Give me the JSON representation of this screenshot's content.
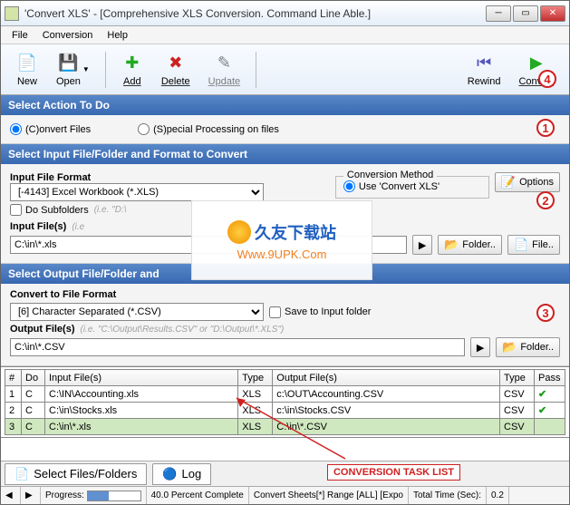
{
  "window": {
    "title": "'Convert XLS' - [Comprehensive XLS Conversion.  Command Line Able.]"
  },
  "menu": {
    "file": "File",
    "conversion": "Conversion",
    "help": "Help"
  },
  "toolbar": {
    "new": "New",
    "open": "Open",
    "add": "Add",
    "delete": "Delete",
    "update": "Update",
    "rewind": "Rewind",
    "convert": "Convert"
  },
  "annot": {
    "n1": "1",
    "n2": "2",
    "n3": "3",
    "n4": "4",
    "task_list": "CONVERSION TASK LIST"
  },
  "section1": {
    "header": "Select Action To Do",
    "opt_convert": "(C)onvert Files",
    "opt_special": "(S)pecial Processing on files"
  },
  "section2": {
    "header": "Select Input File/Folder and Format to Convert",
    "in_format_label": "Input File Format",
    "in_format_value": "[-4143] Excel Workbook (*.XLS)",
    "do_subfolders": "Do Subfolders",
    "hint_sub": "(i.e. \"D:\\",
    "in_files_label": "Input File(s)",
    "hint_input": "(i.e",
    "in_files_value": "C:\\in\\*.xls",
    "conv_method_legend": "Conversion Method",
    "conv_method_opt1": "Use 'Convert XLS'",
    "options_btn": "Options",
    "folder_btn": "Folder..",
    "file_btn": "File.."
  },
  "section3": {
    "header": "Select Output File/Folder and",
    "out_format_label": "Convert to File Format",
    "out_format_value": "[6] Character Separated (*.CSV)",
    "save_input": "Save to Input folder",
    "out_files_label": "Output File(s)",
    "hint_output": "(i.e. \"C:\\Output\\Results.CSV\" or \"D:\\Output\\*.XLS\")",
    "out_files_value": "C:\\in\\*.CSV",
    "folder_btn": "Folder.."
  },
  "table": {
    "headers": {
      "num": "#",
      "do": "Do",
      "input": "Input File(s)",
      "type1": "Type",
      "output": "Output File(s)",
      "type2": "Type",
      "pass": "Pass"
    },
    "rows": [
      {
        "n": "1",
        "do": "C",
        "in": "C:\\IN\\Accounting.xls",
        "t1": "XLS",
        "out": "c:\\OUT\\Accounting.CSV",
        "t2": "CSV",
        "pass": "✔"
      },
      {
        "n": "2",
        "do": "C",
        "in": "C:\\in\\Stocks.xls",
        "t1": "XLS",
        "out": "c:\\in\\Stocks.CSV",
        "t2": "CSV",
        "pass": "✔"
      },
      {
        "n": "3",
        "do": "C",
        "in": "C:\\in\\*.xls",
        "t1": "XLS",
        "out": "C:\\in\\*.CSV",
        "t2": "CSV",
        "pass": ""
      }
    ]
  },
  "tabs": {
    "select": "Select Files/Folders",
    "log": "Log"
  },
  "status": {
    "progress_label": "Progress:",
    "percent": "40.0 Percent Complete",
    "sheets": "Convert Sheets[*] Range [ALL] [Expo",
    "time_lbl": "Total Time (Sec):",
    "time_val": "0.2"
  },
  "watermark": {
    "cn": "久友下载站",
    "url": "Www.9UPK.Com"
  }
}
